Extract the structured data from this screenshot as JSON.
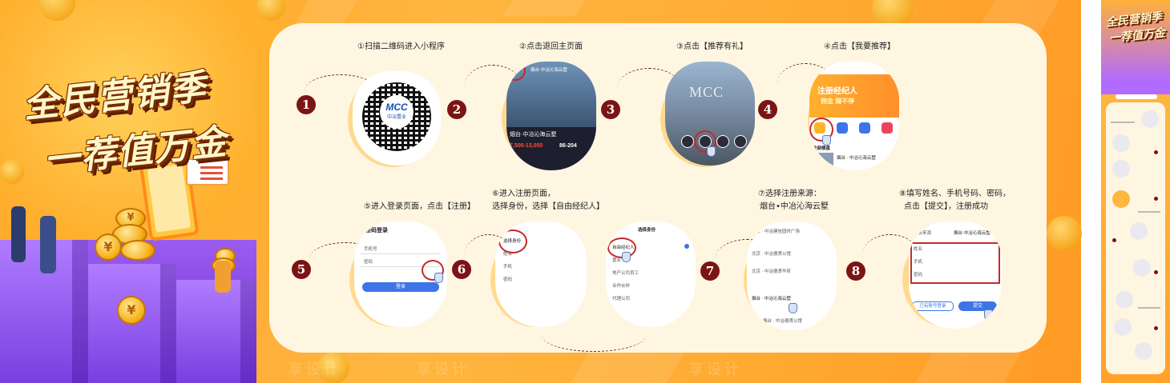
{
  "title": {
    "line1": "全民营销季",
    "line2": "一荐值万金"
  },
  "colors": {
    "orange": "#ffa62e",
    "badge": "#7b1414",
    "purple": "#7a3fe0",
    "panel": "#fff6e2"
  },
  "steps": [
    {
      "num": "1",
      "title": "①扫描二维码进入小程序"
    },
    {
      "num": "2",
      "title": "②点击退回主页面"
    },
    {
      "num": "3",
      "title": "③点击【推荐有礼】"
    },
    {
      "num": "4",
      "title": "④点击【我要推荐】"
    },
    {
      "num": "5",
      "title": "⑤进入登录页面，点击【注册】"
    },
    {
      "num": "6",
      "title_line1": "⑥进入注册页面，",
      "title_line2": "选择身份，选择【自由经纪人】"
    },
    {
      "num": "7",
      "title_line1": "⑦选择注册来源：",
      "title_line2": "烟台•中冶沁海云墅"
    },
    {
      "num": "8",
      "title_line1": "⑧填写姓名、手机号码、密码，",
      "title_line2": "点击【提交】，注册成功"
    }
  ],
  "qr": {
    "logo": "MCC",
    "brand": "中冶置业"
  },
  "screen2": {
    "header": "烟台·中冶沁海云墅",
    "project": "烟台·中冶沁海云墅",
    "price": "7,500-13,000",
    "area": "86-204"
  },
  "screen3": {
    "logo": "MCC"
  },
  "screen4": {
    "banner_l1": "注册经纪人",
    "banner_l2": "佣金 赚不停",
    "section": "全部楼盘",
    "item": "烟台 · 中冶沁海云墅"
  },
  "screen5": {
    "header": "密码登录",
    "phone": "手机号",
    "password": "密码",
    "login": "登录"
  },
  "screen6": {
    "choose": "选择身份",
    "name": "姓名",
    "phone": "手机",
    "password": "密码",
    "dialog": "选择身份",
    "opt1": "自由经纪人",
    "opt2": "置业",
    "opt3": "地产公司员工",
    "opt4": "合作伙伴",
    "opt5": "代理公司"
  },
  "screen7": {
    "row1": "北京 · 中冶建信园时广场",
    "row2": "北京 · 中冶德贤公馆",
    "row3": "北京 · 中冶德贤华府",
    "row4": "烟台 · 中冶沁海云墅",
    "row5": "烟台 · 中冶德贤公馆"
  },
  "screen8": {
    "source": "注册来源",
    "source_val": "烟台·中冶沁海云墅",
    "name": "姓名",
    "phone": "手机",
    "password": "密码",
    "back": "已有账号登录",
    "submit": "提交"
  },
  "watermark": "享设计",
  "strip": {
    "title_l1": "全民营销季",
    "title_l2": "一荐值万金"
  }
}
